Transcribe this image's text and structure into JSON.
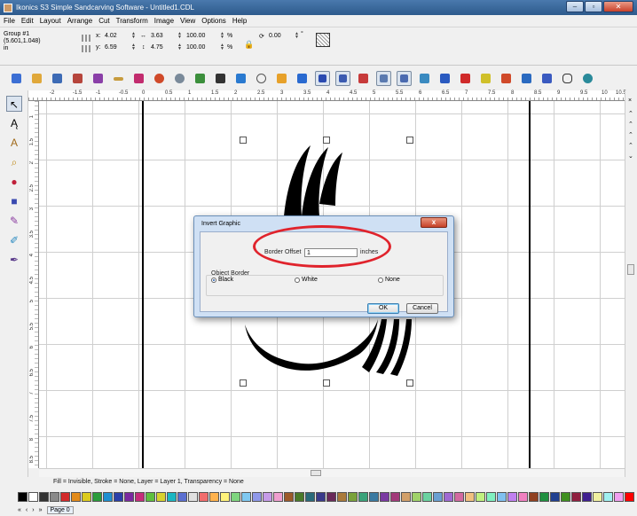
{
  "window": {
    "title": "Ikonics S3 Simple Sandcarving Software - Untitled1.CDL",
    "controls": [
      "–",
      "▫",
      "✕"
    ]
  },
  "menu": [
    "File",
    "Edit",
    "Layout",
    "Arrange",
    "Cut",
    "Transform",
    "Image",
    "View",
    "Options",
    "Help"
  ],
  "properties": {
    "group_label": "Group #1",
    "group_coords": "(5.601,1.048)",
    "units": "in",
    "x_label": "x:",
    "x_value": "4.02",
    "y_label": "y:",
    "y_value": "6.59",
    "width_value": "3.63",
    "height_value": "4.75",
    "scale_x": "100.00",
    "scale_y": "100.00",
    "percent": "%",
    "rotation_value": "0.00",
    "degree": "°"
  },
  "toolbar": {
    "icons": [
      "new-doc-icon",
      "open-icon",
      "save-icon",
      "print-icon",
      "import-icon",
      "export-icon",
      "cut-icon",
      "undo-icon",
      "redo-icon",
      "add-node-icon",
      "move-icon",
      "align-icon",
      "circle-icon",
      "fill-icon",
      "stroke-icon",
      "select-tool-icon",
      "view-icon",
      "grid-icon",
      "node-edit-icon",
      "shape-edit-icon",
      "pattern-icon",
      "bar-icon",
      "flag-icon",
      "marker-icon",
      "star-icon",
      "brush-icon",
      "eraser-icon",
      "hand-icon",
      "zoom-icon"
    ]
  },
  "ruler": {
    "h_ticks": [
      "-2",
      "-1.5",
      "-1",
      "-0.5",
      "0",
      "0.5",
      "1",
      "1.5",
      "2",
      "2.5",
      "3",
      "3.5",
      "4",
      "4.5",
      "5",
      "5.5",
      "6",
      "6.5",
      "7",
      "7.5",
      "8",
      "8.5",
      "9",
      "9.5",
      "10",
      "10.5"
    ],
    "v_ticks": [
      "1",
      "1.5",
      "2",
      "2.5",
      "3",
      "3.5",
      "4",
      "4.5",
      "5",
      "5.5",
      "6",
      "6.5",
      "7",
      "7.5",
      "8",
      "8.5"
    ]
  },
  "left_tools": [
    "select-arrow-icon",
    "node-arrow-icon",
    "text-tool-icon",
    "zoom-tool-icon",
    "color-fill-icon",
    "shapes-tool-icon",
    "pen-tool-icon",
    "eyedropper-icon",
    "calligraphy-icon"
  ],
  "right_strip": [
    "×",
    "⌃",
    "⌃",
    "⌃",
    "⌃",
    "⌄"
  ],
  "status": {
    "text": "Fill = Invisible, Stroke = None, Layer = Layer 1, Transparency = None"
  },
  "palette": {
    "colors": [
      "#000000",
      "#ffffff",
      "#333333",
      "#8a8a8a",
      "#d22a2a",
      "#e38b1a",
      "#dccb1f",
      "#2a9c3b",
      "#1f8fd0",
      "#2a3fa8",
      "#7b2aa0",
      "#c52d7b",
      "#5fbf3f",
      "#d8d12e",
      "#1bb6c2",
      "#5b6fd0",
      "#e0e0e0",
      "#f26d6d",
      "#ffb24d",
      "#fff27a",
      "#7fd57f",
      "#7fc8f0",
      "#8f98e8",
      "#c69ce8",
      "#ef9fcf",
      "#9c5a2a",
      "#4a7a2a",
      "#2a6a7a",
      "#3a3a8a",
      "#6a2a5a",
      "#aa7a3a",
      "#7aa23a",
      "#3aa27a",
      "#3a7aa2",
      "#7a3aa2",
      "#a23a7a",
      "#d2a06a",
      "#a0d26a",
      "#6ad2a0",
      "#6aa0d2",
      "#a06ad2",
      "#d26aa0",
      "#f0c080",
      "#c0f080",
      "#80f0c0",
      "#80c0f0",
      "#c080f0",
      "#f080c0",
      "#904020",
      "#209040",
      "#204090",
      "#409020",
      "#902040",
      "#402090",
      "#f0f0a0",
      "#a0f0f0",
      "#f0a0f0",
      "#ff0000"
    ]
  },
  "page_nav": {
    "buttons": [
      "«",
      "‹",
      "›",
      "»"
    ],
    "page_label": "Page 0"
  },
  "dialog": {
    "title": "Invert Graphic",
    "close": "x",
    "border_offset_label": "Border Offset",
    "border_offset_value": "1",
    "units_label": "inches",
    "group_label": "Object Border",
    "options": [
      {
        "label": "Black",
        "checked": true
      },
      {
        "label": "White",
        "checked": false
      },
      {
        "label": "None",
        "checked": false
      }
    ],
    "ok_label": "OK",
    "cancel_label": "Cancel"
  },
  "colors": {
    "titlebar": "#2d5a8c",
    "dialog_frame": "#cfe0f4",
    "highlight_ellipse": "#e0232c",
    "graphic": "#000000"
  }
}
